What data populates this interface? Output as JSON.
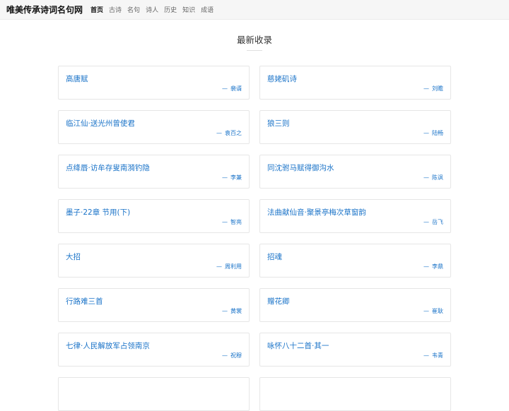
{
  "site": {
    "brand": "唯美传承诗词名句网"
  },
  "nav": {
    "items": [
      {
        "label": "首页",
        "active": true
      },
      {
        "label": "古诗",
        "active": false
      },
      {
        "label": "名句",
        "active": false
      },
      {
        "label": "诗人",
        "active": false
      },
      {
        "label": "历史",
        "active": false
      },
      {
        "label": "知识",
        "active": false
      },
      {
        "label": "成语",
        "active": false
      }
    ]
  },
  "section": {
    "title": "最新收录"
  },
  "author_prefix": "—",
  "cards": [
    {
      "title": "高唐赋",
      "author": "裴谞"
    },
    {
      "title": "慈姥矶诗",
      "author": "刘瞻"
    },
    {
      "title": "临江仙·送光州曾使君",
      "author": "袁百之"
    },
    {
      "title": "狼三则",
      "author": "陆畅"
    },
    {
      "title": "点绛唇·访牟存叟南漪钓隐",
      "author": "李兼"
    },
    {
      "title": "同沈驸马赋得御沟水",
      "author": "陈讽"
    },
    {
      "title": "墨子·22章 节用(下)",
      "author": "智亮"
    },
    {
      "title": "法曲献仙音·聚景亭梅次草窗韵",
      "author": "岳飞"
    },
    {
      "title": "大招",
      "author": "周利用"
    },
    {
      "title": "招魂",
      "author": "李鼎"
    },
    {
      "title": "行路难三首",
      "author": "黄裳"
    },
    {
      "title": "赠花卿",
      "author": "崔耿"
    },
    {
      "title": "七律·人民解放军占领南京",
      "author": "祝穆"
    },
    {
      "title": "咏怀八十二首·其一",
      "author": "韦青"
    },
    {
      "title": "",
      "author": ""
    },
    {
      "title": "",
      "author": ""
    }
  ]
}
